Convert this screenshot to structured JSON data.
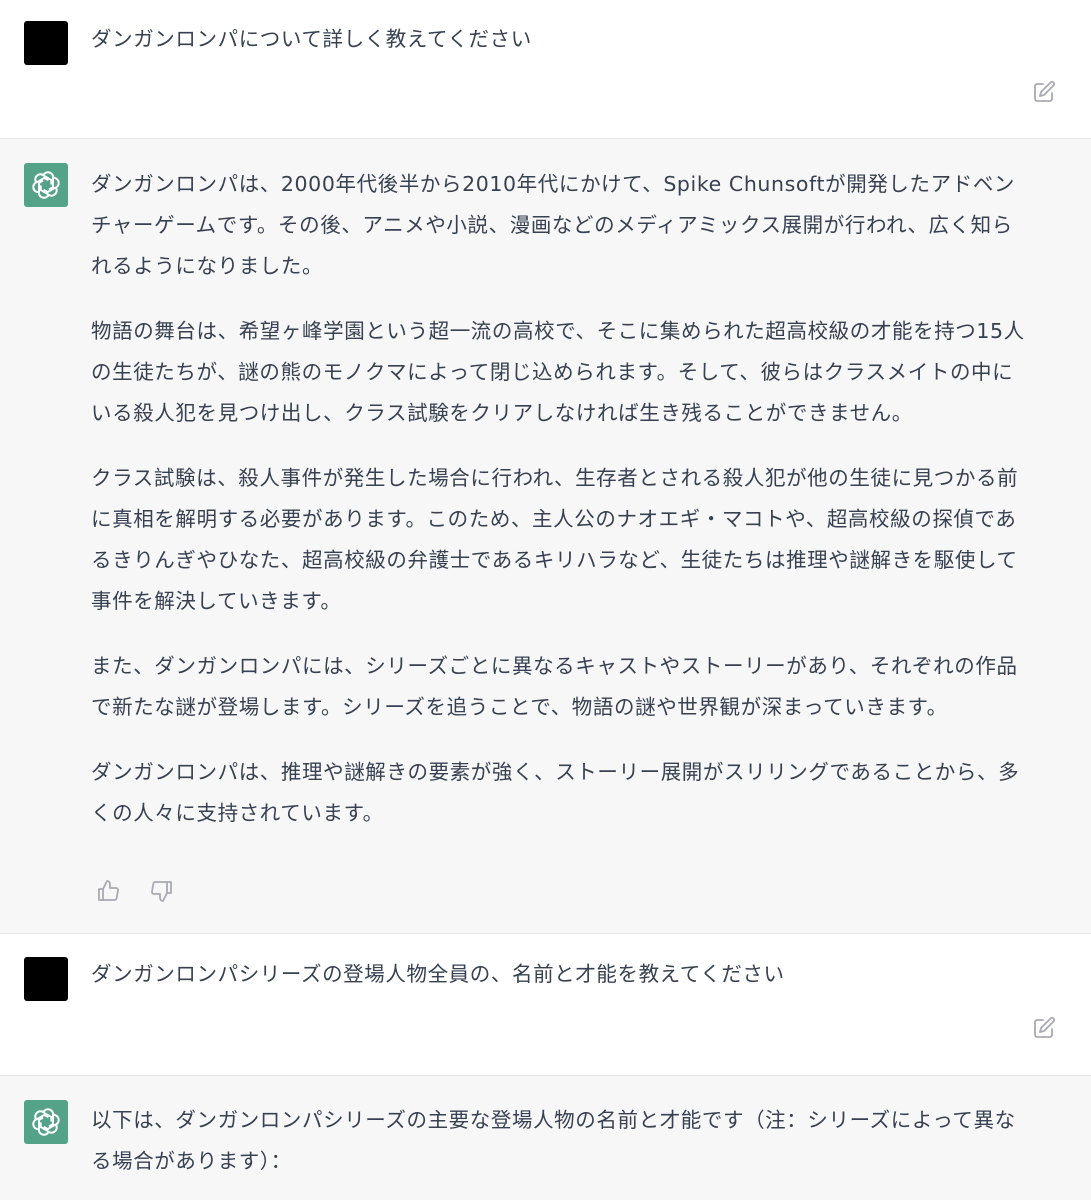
{
  "conversation": {
    "user1": {
      "text": "ダンガンロンパについて詳しく教えてください"
    },
    "assistant1": {
      "paragraphs": [
        {
          "lines": [
            "ダンガンロンパは、2000年代後半から2010年代にかけて、Spike Chunsoftが開発したアドベン",
            "チャーゲームです。その後、アニメや小説、漫画などのメディアミックス展開が行われ、広く知ら",
            "れるようになりました。"
          ]
        },
        {
          "lines": [
            "物語の舞台は、希望ヶ峰学園という超一流の高校で、そこに集められた超高校級の才能を持つ15人",
            "の生徒たちが、謎の熊のモノクマによって閉じ込められます。そして、彼らはクラスメイトの中に",
            "いる殺人犯を見つけ出し、クラス試験をクリアしなければ生き残ることができません。"
          ]
        },
        {
          "lines": [
            "クラス試験は、殺人事件が発生した場合に行われ、生存者とされる殺人犯が他の生徒に見つかる前",
            "に真相を解明する必要があります。このため、主人公のナオエギ・マコトや、超高校級の探偵であ",
            "るきりんぎやひなた、超高校級の弁護士であるキリハラなど、生徒たちは推理や謎解きを駆使して",
            "事件を解決していきます。"
          ]
        },
        {
          "lines": [
            "また、ダンガンロンパには、シリーズごとに異なるキャストやストーリーがあり、それぞれの作品",
            "で新たな謎が登場します。シリーズを追うことで、物語の謎や世界観が深まっていきます。"
          ]
        },
        {
          "lines": [
            "ダンガンロンパは、推理や謎解きの要素が強く、ストーリー展開がスリリングであることから、多",
            "くの人々に支持されています。"
          ]
        }
      ]
    },
    "user2": {
      "text": "ダンガンロンパシリーズの登場人物全員の、名前と才能を教えてください"
    },
    "assistant2": {
      "lines": [
        "以下は、ダンガンロンパシリーズの主要な登場人物の名前と才能です（注：シリーズによって異な",
        "る場合があります）："
      ]
    }
  },
  "icons": {
    "edit": "edit-icon",
    "thumbs_up": "thumbs-up-icon",
    "thumbs_down": "thumbs-down-icon",
    "assistant_logo": "openai-logo-icon"
  },
  "colors": {
    "assistant_avatar": "#54a287",
    "user_avatar": "#000000",
    "assistant_bg": "#f7f7f8",
    "text": "#374151"
  }
}
